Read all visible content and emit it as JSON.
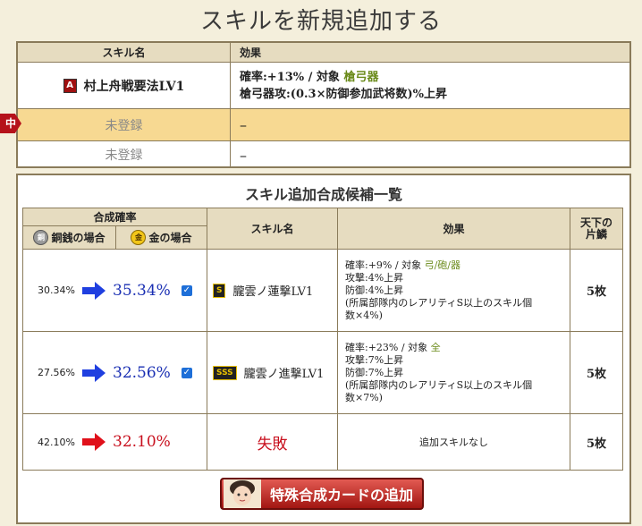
{
  "page": {
    "title": "スキルを新規追加する"
  },
  "current": {
    "header": {
      "name": "スキル名",
      "effect": "効果"
    },
    "rows": [
      {
        "badge": "A",
        "name": "村上舟戦要法LV1",
        "line1_prefix": "確率:+13% / 対象 ",
        "line1_target": "槍弓器",
        "line2": "槍弓器攻:(0.3×防御参加武将数)%上昇"
      },
      {
        "name": "未登録",
        "effect": "–",
        "marker": "中"
      },
      {
        "name": "未登録",
        "effect": "–"
      }
    ]
  },
  "candidates": {
    "title": "スキル追加合成候補一覧",
    "headers": {
      "rate": "合成確率",
      "copper": "銅銭の場合",
      "gold": "金の場合",
      "copper_coin": "銅",
      "gold_coin": "金",
      "name": "スキル名",
      "effect": "効果",
      "shards": "天下の\n片鱗"
    },
    "rows": [
      {
        "copper_pct": "30.34%",
        "gold_pct": "35.34%",
        "badge": "S",
        "name": "朧雲ノ蓮撃LV1",
        "effect_prefix": "確率:+9% / 対象 ",
        "effect_target": "弓/砲/器",
        "effect_lines": [
          "攻撃:4%上昇",
          "防御:4%上昇",
          "(所属部隊内のレアリティS以上のスキル個",
          "数×4%)"
        ],
        "count": "5枚"
      },
      {
        "copper_pct": "27.56%",
        "gold_pct": "32.56%",
        "badge": "SSS",
        "name": "朧雲ノ進撃LV1",
        "effect_prefix": "確率:+23% / 対象 ",
        "effect_target": "全",
        "effect_lines": [
          "攻撃:7%上昇",
          "防御:7%上昇",
          "(所属部隊内のレアリティS以上のスキル個",
          "数×7%)"
        ],
        "count": "5枚"
      },
      {
        "copper_pct": "42.10%",
        "gold_pct": "32.10%",
        "name": "失敗",
        "effect": "追加スキルなし",
        "count": "5枚"
      }
    ]
  },
  "button": {
    "label": "特殊合成カードの追加"
  },
  "colors": {
    "blue_arrow": "#1f3fe0",
    "red_arrow": "#e0101a",
    "accent": "#b5121b"
  }
}
